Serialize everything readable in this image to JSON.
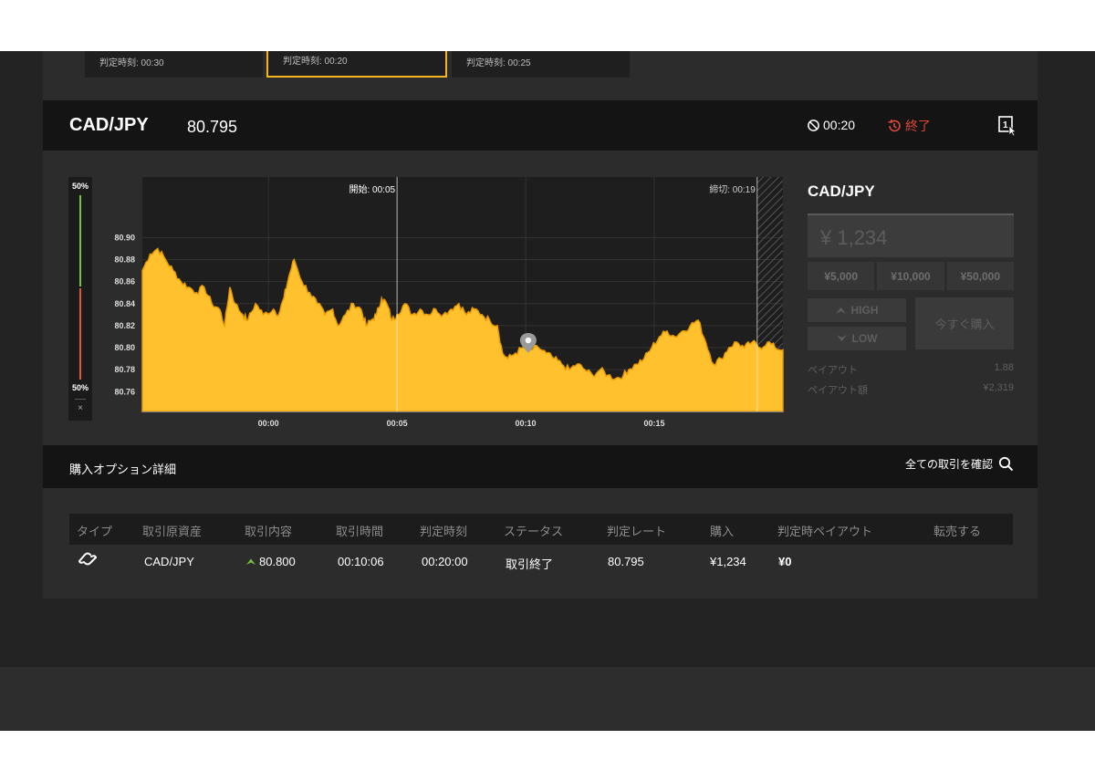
{
  "top_cards": [
    {
      "label": "判定時刻: 00:30",
      "selected": false
    },
    {
      "label": "判定時刻: 00:20",
      "selected": true
    },
    {
      "label": "判定時刻: 00:25",
      "selected": false
    }
  ],
  "header": {
    "pair": "CAD/JPY",
    "price": "80.795",
    "timer": "00:20",
    "status": "終了",
    "icons": {
      "timer": "no-entry-icon",
      "status": "history-icon",
      "select": "select-cursor-icon"
    }
  },
  "gauge": {
    "top_pct": "50%",
    "bottom_pct": "50%",
    "close": "×",
    "colors": {
      "up": "#7cc23a",
      "down": "#e0573a"
    }
  },
  "chart_data": {
    "type": "area",
    "y_ticks": [
      "80.90",
      "80.88",
      "80.86",
      "80.84",
      "80.82",
      "80.80",
      "80.78",
      "80.76"
    ],
    "ylim": [
      80.742,
      80.955
    ],
    "x_ticks": [
      {
        "label": "00:00",
        "t": 0
      },
      {
        "label": "00:05",
        "t": 5
      },
      {
        "label": "00:10",
        "t": 10
      },
      {
        "label": "00:15",
        "t": 15
      }
    ],
    "xlim": [
      -4.9,
      20
    ],
    "start_label": "開始: 00:05",
    "start_t": 5,
    "end_label": "締切: 00:19",
    "end_t": 19,
    "entry_point": {
      "t": 10.1,
      "y": 80.8
    },
    "grid": true,
    "fill_color": "#ffc22e",
    "points": [
      [
        -4.9,
        80.87
      ],
      [
        -4.6,
        80.885
      ],
      [
        -4.3,
        80.89
      ],
      [
        -4.0,
        80.88
      ],
      [
        -3.7,
        80.87
      ],
      [
        -3.4,
        80.86
      ],
      [
        -3.1,
        80.855
      ],
      [
        -2.8,
        80.85
      ],
      [
        -2.5,
        80.855
      ],
      [
        -2.2,
        80.84
      ],
      [
        -1.9,
        80.835
      ],
      [
        -1.7,
        80.82
      ],
      [
        -1.5,
        80.855
      ],
      [
        -1.3,
        80.84
      ],
      [
        -1.0,
        80.83
      ],
      [
        -0.8,
        80.825
      ],
      [
        -0.5,
        80.84
      ],
      [
        -0.2,
        80.83
      ],
      [
        0.2,
        80.835
      ],
      [
        0.4,
        80.83
      ],
      [
        0.6,
        80.845
      ],
      [
        0.8,
        80.865
      ],
      [
        1.0,
        80.88
      ],
      [
        1.3,
        80.86
      ],
      [
        1.6,
        80.85
      ],
      [
        1.9,
        80.84
      ],
      [
        2.2,
        80.83
      ],
      [
        2.5,
        80.835
      ],
      [
        2.7,
        80.82
      ],
      [
        3.0,
        80.83
      ],
      [
        3.3,
        80.84
      ],
      [
        3.6,
        80.835
      ],
      [
        3.8,
        80.82
      ],
      [
        4.0,
        80.825
      ],
      [
        4.2,
        80.83
      ],
      [
        4.4,
        80.845
      ],
      [
        4.6,
        80.84
      ],
      [
        4.8,
        80.825
      ],
      [
        5.0,
        80.83
      ],
      [
        5.3,
        80.84
      ],
      [
        5.6,
        80.83
      ],
      [
        5.9,
        80.835
      ],
      [
        6.2,
        80.83
      ],
      [
        6.5,
        80.835
      ],
      [
        6.8,
        80.83
      ],
      [
        7.1,
        80.835
      ],
      [
        7.4,
        80.84
      ],
      [
        7.7,
        80.83
      ],
      [
        8.0,
        80.835
      ],
      [
        8.3,
        80.83
      ],
      [
        8.6,
        80.825
      ],
      [
        8.9,
        80.82
      ],
      [
        9.1,
        80.795
      ],
      [
        9.3,
        80.79
      ],
      [
        9.6,
        80.795
      ],
      [
        9.9,
        80.8
      ],
      [
        10.2,
        80.798
      ],
      [
        10.5,
        80.8
      ],
      [
        10.8,
        80.795
      ],
      [
        11.1,
        80.79
      ],
      [
        11.4,
        80.785
      ],
      [
        11.7,
        80.78
      ],
      [
        12.0,
        80.785
      ],
      [
        12.3,
        80.78
      ],
      [
        12.6,
        80.775
      ],
      [
        12.9,
        80.78
      ],
      [
        13.2,
        80.775
      ],
      [
        13.5,
        80.772
      ],
      [
        13.8,
        80.775
      ],
      [
        14.0,
        80.78
      ],
      [
        14.3,
        80.785
      ],
      [
        14.6,
        80.79
      ],
      [
        14.9,
        80.8
      ],
      [
        15.2,
        80.81
      ],
      [
        15.5,
        80.815
      ],
      [
        15.8,
        80.81
      ],
      [
        16.1,
        80.815
      ],
      [
        16.4,
        80.82
      ],
      [
        16.7,
        80.825
      ],
      [
        17.0,
        80.805
      ],
      [
        17.3,
        80.785
      ],
      [
        17.6,
        80.79
      ],
      [
        17.9,
        80.8
      ],
      [
        18.2,
        80.805
      ],
      [
        18.5,
        80.8
      ],
      [
        18.8,
        80.805
      ],
      [
        19.1,
        80.8
      ],
      [
        19.4,
        80.805
      ],
      [
        19.7,
        80.8
      ],
      [
        20.0,
        80.798
      ]
    ]
  },
  "trade": {
    "title": "CAD/JPY",
    "amount": "¥ 1,234",
    "presets": [
      "¥5,000",
      "¥10,000",
      "¥50,000"
    ],
    "high": "HIGH",
    "low": "LOW",
    "buy_now": "今すぐ購入",
    "payout_label": "ペイアウト",
    "payout_value": "1.88",
    "payout_amount_label": "ペイアウト額",
    "payout_amount_value": "¥2,319"
  },
  "details": {
    "title": "購入オプション詳細",
    "check_all": "全ての取引を確認"
  },
  "table": {
    "headers": [
      "タイプ",
      "取引原資産",
      "取引内容",
      "取引時間",
      "判定時刻",
      "ステータス",
      "判定レート",
      "購入",
      "判定時ペイアウト",
      "転売する"
    ],
    "rows": [
      {
        "type_icon": "link-icon",
        "asset": "CAD/JPY",
        "content": "80.800",
        "time": "00:10:06",
        "judge_time": "00:20:00",
        "status": "取引終了",
        "rate": "80.795",
        "purchase": "¥1,234",
        "payout": "¥0"
      }
    ]
  }
}
